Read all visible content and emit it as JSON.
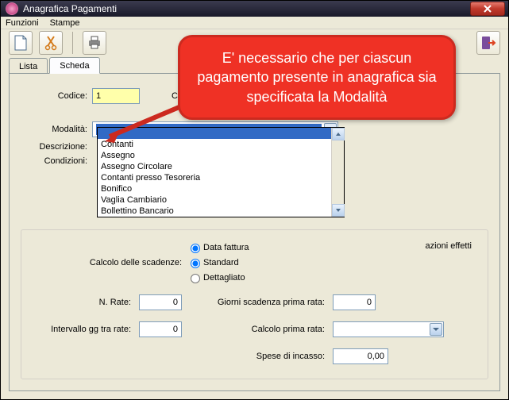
{
  "window": {
    "title": "Anagrafica Pagamenti"
  },
  "menu": {
    "funzioni": "Funzioni",
    "stampe": "Stampe"
  },
  "tabs": {
    "lista": "Lista",
    "scheda": "Scheda"
  },
  "form": {
    "codice_label": "Codice:",
    "codice_value": "1",
    "co_label": "Co",
    "modalita_label": "Modalità:",
    "descrizione_label": "Descrizione:",
    "condizioni_label": "Condizioni:"
  },
  "dropdown_items": [
    "",
    "Contanti",
    "Assegno",
    "Assegno Circolare",
    "Contanti presso Tesoreria",
    "Bonifico",
    "Vaglia Cambiario",
    "Bollettino Bancario"
  ],
  "group": {
    "effetti_label": "azioni effetti",
    "data_fattura": "Data fattura",
    "calcolo_scadenze_label": "Calcolo delle scadenze:",
    "standard": "Standard",
    "dettagliato": "Dettagliato",
    "n_rate_label": "N. Rate:",
    "n_rate_value": "0",
    "gg_scadenza_label": "Giorni scadenza prima rata:",
    "gg_scadenza_value": "0",
    "intervallo_label": "Intervallo gg tra rate:",
    "intervallo_value": "0",
    "calcolo_prima_rata_label": "Calcolo prima rata:",
    "spese_incasso_label": "Spese di incasso:",
    "spese_incasso_value": "0,00"
  },
  "callout": {
    "text": "E' necessario che per ciascun pagamento presente in anagrafica sia specificata la Modalità"
  }
}
